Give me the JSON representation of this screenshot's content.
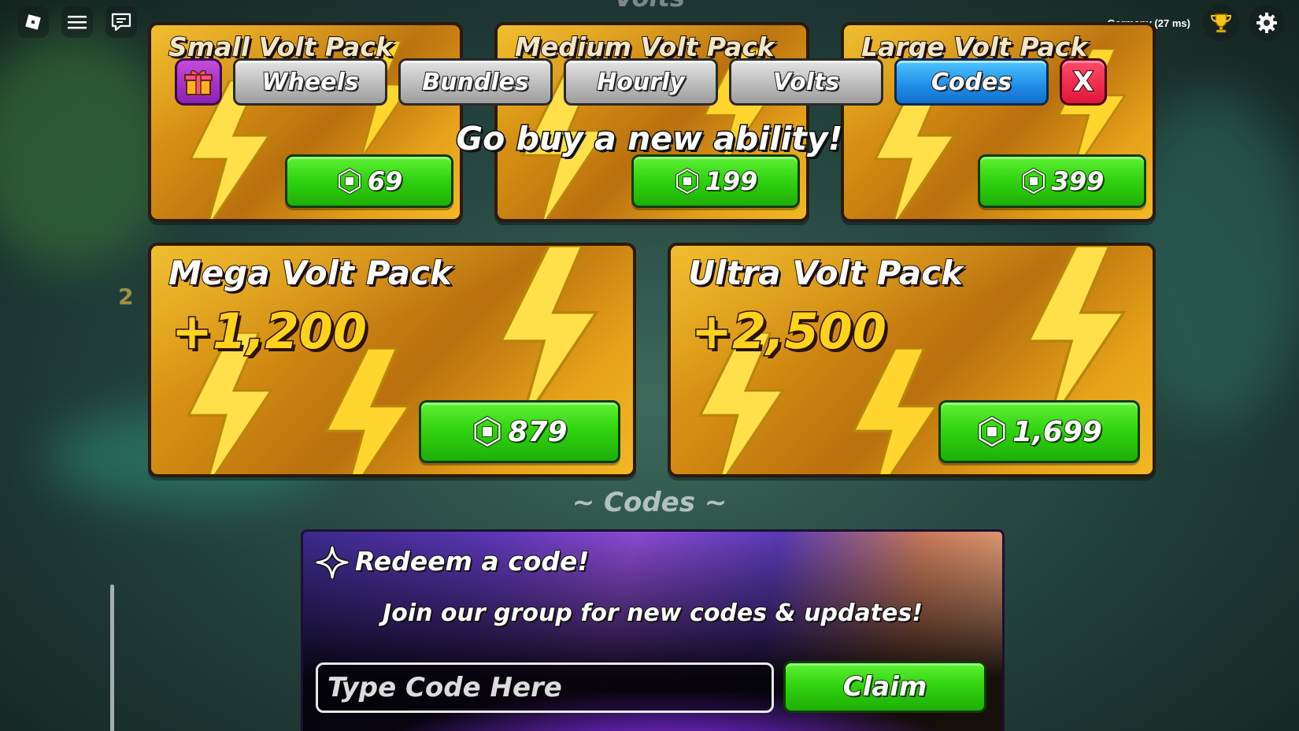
{
  "topbar": {
    "server_status": "Germany (27 ms)"
  },
  "background": {
    "header_partial": "Volts",
    "side_badge": "2"
  },
  "tabs": {
    "items": [
      {
        "label": "Wheels",
        "active": false
      },
      {
        "label": "Bundles",
        "active": false
      },
      {
        "label": "Hourly",
        "active": false
      },
      {
        "label": "Volts",
        "active": false
      },
      {
        "label": "Codes",
        "active": true
      }
    ],
    "close_label": "X"
  },
  "banner": {
    "text": "Go buy a new ability!"
  },
  "packs": {
    "small": {
      "title": "Small Volt Pack",
      "price": "69"
    },
    "medium": {
      "title": "Medium Volt Pack",
      "price": "199"
    },
    "large": {
      "title": "Large Volt Pack",
      "price": "399"
    },
    "mega": {
      "title": "Mega Volt Pack",
      "amount": "+1,200",
      "price": "879"
    },
    "ultra": {
      "title": "Ultra Volt Pack",
      "amount": "+2,500",
      "price": "1,699"
    }
  },
  "codes": {
    "header": "~ Codes ~",
    "title": "Redeem a code!",
    "subtitle": "Join our group for new codes & updates!",
    "input_placeholder": "Type Code Here",
    "input_value": "",
    "claim_label": "Claim"
  },
  "colors": {
    "pack_gold": "#e8a818",
    "price_green": "#2fd10f",
    "tab_active_blue": "#1f8ce8",
    "close_red": "#e0163a",
    "gift_purple": "#8a21b2"
  }
}
